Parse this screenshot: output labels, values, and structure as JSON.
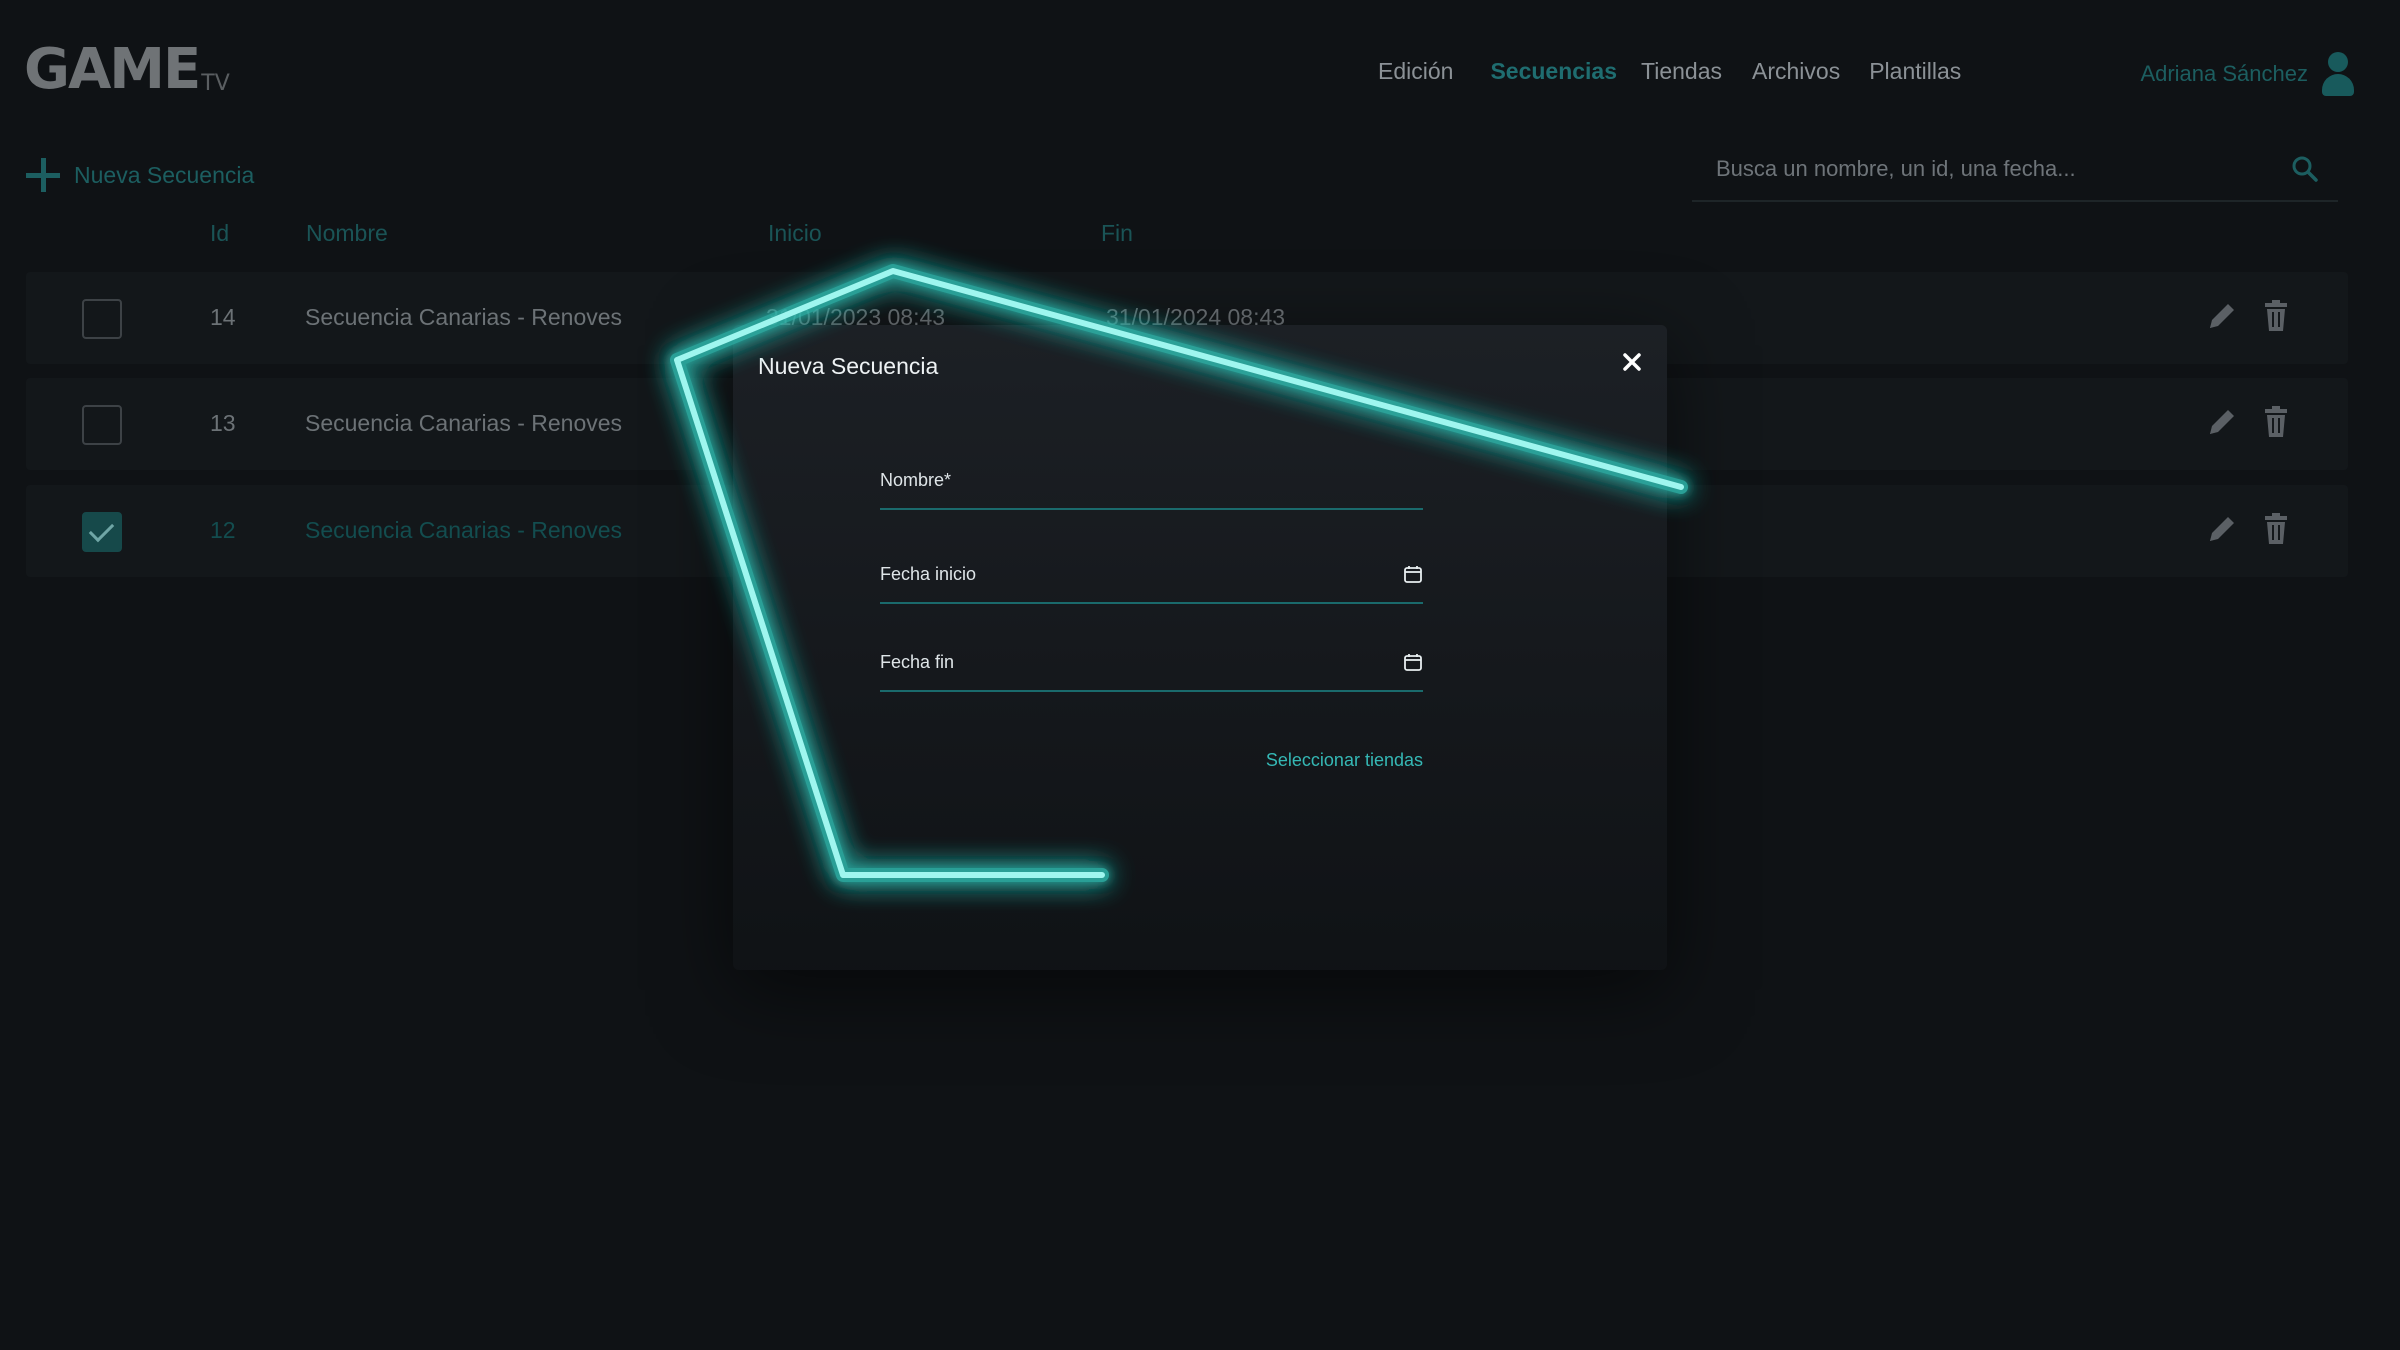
{
  "app": {
    "logo_main": "GAME",
    "logo_sub": "TV"
  },
  "nav": {
    "items": [
      {
        "label": "Edición",
        "active": false
      },
      {
        "label": "Secuencias",
        "active": true
      },
      {
        "label": "Tiendas",
        "active": false
      },
      {
        "label": "Archivos",
        "active": false
      },
      {
        "label": "Plantillas",
        "active": false
      }
    ]
  },
  "user": {
    "name": "Adriana Sánchez",
    "icon": "user-icon"
  },
  "toolbar": {
    "new_label": "Nueva Secuencia",
    "icon": "plus-icon"
  },
  "search": {
    "placeholder": "Busca un nombre, un id, una fecha...",
    "icon": "search-icon"
  },
  "table": {
    "headers": {
      "id": "Id",
      "name": "Nombre",
      "start": "Inicio",
      "end": "Fin"
    },
    "rows": [
      {
        "id": "14",
        "name": "Secuencia Canarias - Renoves",
        "start": "31/01/2023 08:43",
        "end": "31/01/2024 08:43",
        "checked": false
      },
      {
        "id": "13",
        "name": "Secuencia Canarias - Renoves",
        "start": "",
        "end": "",
        "checked": false
      },
      {
        "id": "12",
        "name": "Secuencia Canarias - Renoves",
        "start": "",
        "end": "",
        "checked": true
      }
    ],
    "actions": {
      "edit_icon": "pencil-icon",
      "delete_icon": "trash-icon"
    }
  },
  "modal": {
    "title": "Nueva Secuencia",
    "close_icon": "close-icon",
    "fields": {
      "name_label": "Nombre*",
      "start_label": "Fecha inicio",
      "end_label": "Fecha fin"
    },
    "select_stores": "Seleccionar tiendas"
  },
  "colors": {
    "accent": "#35b8b5",
    "glow": "#8ff3ec",
    "background": "#0f1215"
  }
}
